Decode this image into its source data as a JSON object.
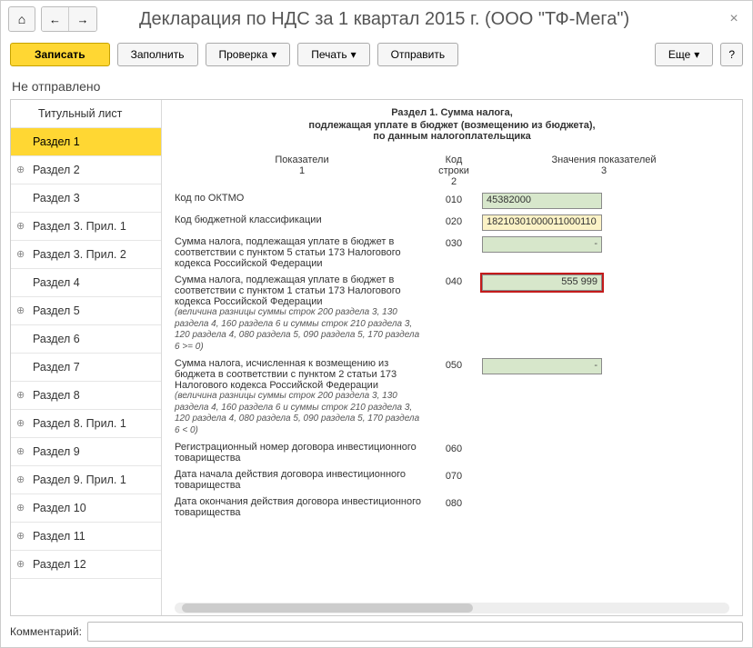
{
  "header": {
    "title": "Декларация по НДС за 1 квартал 2015 г. (ООО \"ТФ-Мега\")"
  },
  "toolbar": {
    "save": "Записать",
    "fill": "Заполнить",
    "check": "Проверка",
    "print": "Печать",
    "send": "Отправить",
    "more": "Еще",
    "help": "?"
  },
  "status": "Не отправлено",
  "sidebar": [
    {
      "label": "Титульный лист",
      "expandable": false,
      "active": false
    },
    {
      "label": "Раздел 1",
      "expandable": false,
      "active": true
    },
    {
      "label": "Раздел 2",
      "expandable": true,
      "active": false
    },
    {
      "label": "Раздел 3",
      "expandable": false,
      "active": false
    },
    {
      "label": "Раздел 3. Прил. 1",
      "expandable": true,
      "active": false
    },
    {
      "label": "Раздел 3. Прил. 2",
      "expandable": true,
      "active": false
    },
    {
      "label": "Раздел 4",
      "expandable": false,
      "active": false
    },
    {
      "label": "Раздел 5",
      "expandable": true,
      "active": false
    },
    {
      "label": "Раздел 6",
      "expandable": false,
      "active": false
    },
    {
      "label": "Раздел 7",
      "expandable": false,
      "active": false
    },
    {
      "label": "Раздел 8",
      "expandable": true,
      "active": false
    },
    {
      "label": "Раздел 8. Прил. 1",
      "expandable": true,
      "active": false
    },
    {
      "label": "Раздел 9",
      "expandable": true,
      "active": false
    },
    {
      "label": "Раздел 9. Прил. 1",
      "expandable": true,
      "active": false
    },
    {
      "label": "Раздел 10",
      "expandable": true,
      "active": false
    },
    {
      "label": "Раздел 11",
      "expandable": true,
      "active": false
    },
    {
      "label": "Раздел 12",
      "expandable": true,
      "active": false
    }
  ],
  "section": {
    "title": "Раздел 1. Сумма налога,",
    "sub1": "подлежащая уплате в бюджет (возмещению из бюджета),",
    "sub2": "по данным налогоплательщика",
    "col1": "Показатели",
    "col1n": "1",
    "col2": "Код строки",
    "col2n": "2",
    "col3": "Значения показателей",
    "col3n": "3"
  },
  "rows": {
    "r010": {
      "label": "Код по ОКТМО",
      "code": "010",
      "value": "45382000"
    },
    "r020": {
      "label": "Код бюджетной классификации",
      "code": "020",
      "value": "18210301000011000110"
    },
    "r030": {
      "label": "Сумма налога, подлежащая уплате в бюджет в соответствии с пунктом 5 статьи 173 Налогового кодекса Российской Федерации",
      "code": "030",
      "value": ""
    },
    "r040": {
      "label": "Сумма налога, подлежащая уплате в бюджет в соответствии с пунктом 1 статьи 173 Налогового кодекса Российской Федерации",
      "note": "(величина разницы суммы строк 200 раздела 3, 130 раздела 4, 160 раздела 6 и суммы строк 210 раздела 3, 120 раздела 4, 080 раздела 5, 090 раздела 5, 170 раздела 6 >= 0)",
      "code": "040",
      "value": "555 999"
    },
    "r050": {
      "label": "Сумма налога, исчисленная к возмещению из бюджета в соответствии с пунктом 2 статьи 173 Налогового кодекса Российской Федерации",
      "note": "(величина разницы суммы строк 200 раздела 3, 130 раздела 4, 160 раздела 6 и суммы строк 210 раздела 3, 120 раздела 4, 080 раздела 5, 090 раздела 5, 170 раздела 6 < 0)",
      "code": "050",
      "value": ""
    },
    "r060": {
      "label": "Регистрационный номер договора инвестиционного товарищества",
      "code": "060",
      "value": ""
    },
    "r070": {
      "label": "Дата начала действия договора инвестиционного товарищества",
      "code": "070",
      "value": ""
    },
    "r080": {
      "label": "Дата окончания действия договора инвестиционного товарищества",
      "code": "080",
      "value": ""
    }
  },
  "footer": {
    "comment_label": "Комментарий:",
    "comment_value": ""
  }
}
